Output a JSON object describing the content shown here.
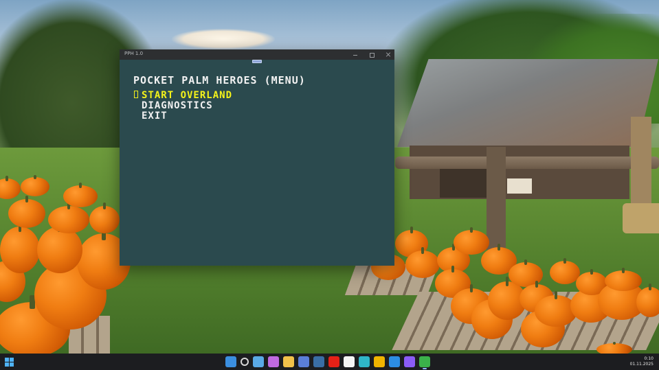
{
  "window": {
    "title": "PPH 1.0",
    "heading": "POCKET PALM HEROES (MENU)",
    "menu_items": [
      {
        "label": "START OVERLAND",
        "selected": true
      },
      {
        "label": "DIAGNOSTICS",
        "selected": false
      },
      {
        "label": "EXIT",
        "selected": false
      }
    ],
    "colors": {
      "background": "#2b4a4e",
      "text": "#f2f2f2",
      "selected": "#f4f21a"
    }
  },
  "taskbar": {
    "icons": [
      {
        "name": "windows-widgets-icon",
        "color": "#3b8fe0"
      },
      {
        "name": "search-icon",
        "color": "#d9d9d9"
      },
      {
        "name": "notepad-icon",
        "color": "#5aa9e6"
      },
      {
        "name": "copilot-icon",
        "color": "#c06ae0"
      },
      {
        "name": "file-explorer-icon",
        "color": "#f2c14a"
      },
      {
        "name": "save-icon",
        "color": "#5a7ed8"
      },
      {
        "name": "steam-icon",
        "color": "#3a6ea5"
      },
      {
        "name": "youtube-icon",
        "color": "#e62117"
      },
      {
        "name": "yandex-browser-icon",
        "color": "#f5f5f5"
      },
      {
        "name": "edge-icon",
        "color": "#2fb5c8"
      },
      {
        "name": "chrome-icon",
        "color": "#f0b400"
      },
      {
        "name": "vscode-icon",
        "color": "#2c8de4"
      },
      {
        "name": "visual-studio-icon",
        "color": "#8b5cf6"
      },
      {
        "name": "game-app-icon",
        "color": "#3bb24a"
      }
    ],
    "time": "0:10",
    "date": "01.11.2025"
  }
}
